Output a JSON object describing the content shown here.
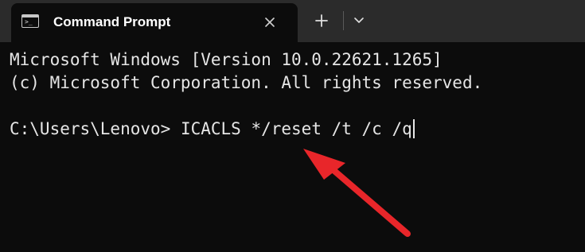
{
  "tab": {
    "title": "Command Prompt",
    "icon": "terminal-icon"
  },
  "tabbar": {
    "new_tab_icon": "plus-icon",
    "dropdown_icon": "chevron-down-icon",
    "close_icon": "close-icon"
  },
  "terminal": {
    "lines": [
      "Microsoft Windows [Version 10.0.22621.1265]",
      "(c) Microsoft Corporation. All rights reserved."
    ],
    "prompt": "C:\\Users\\Lenovo>",
    "command": "ICACLS */reset /t /c /q"
  },
  "annotation": {
    "arrow_color": "#e8262a"
  },
  "colors": {
    "background": "#0c0c0c",
    "titlebar": "#2b2b2b",
    "text": "#e6e6e6"
  }
}
